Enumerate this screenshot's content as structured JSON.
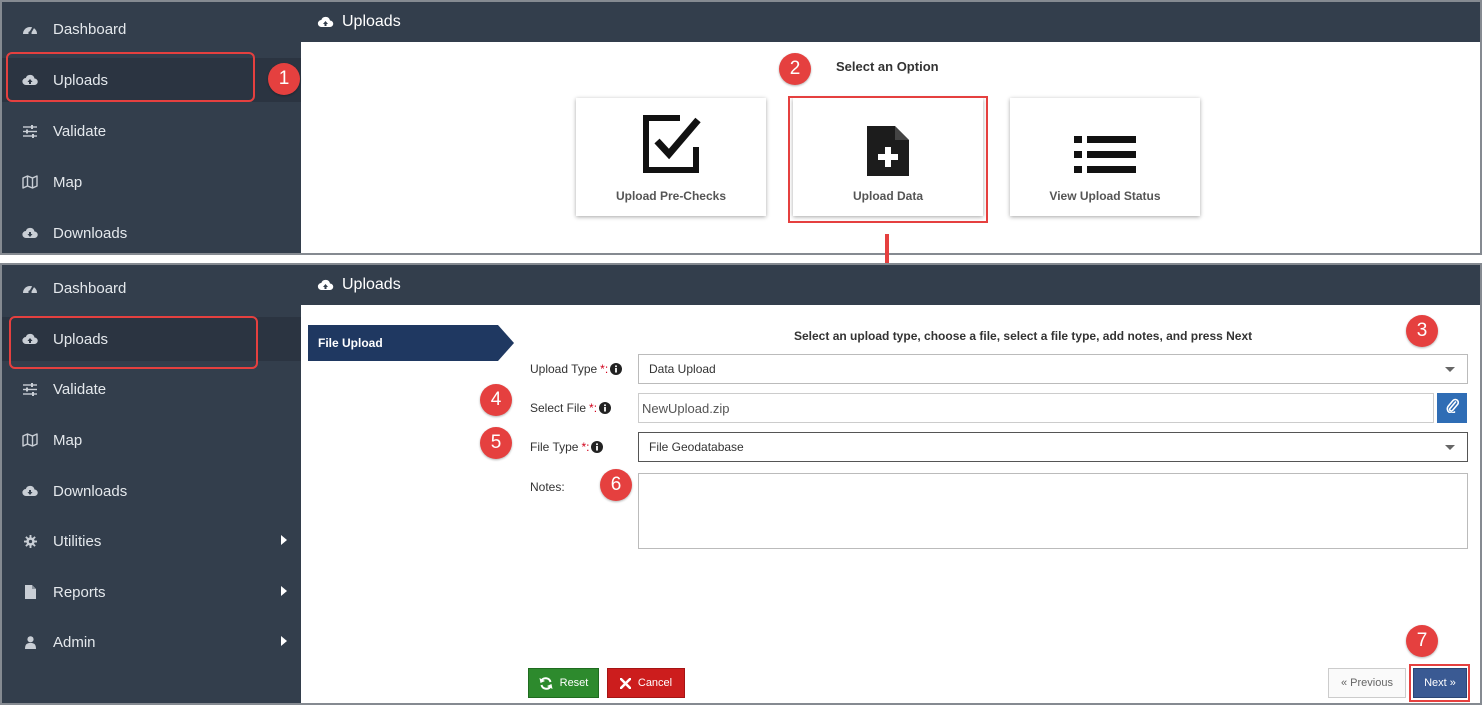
{
  "top": {
    "header_title": "Uploads",
    "sidebar": [
      {
        "label": "Dashboard",
        "icon": "dashboard-icon"
      },
      {
        "label": "Uploads",
        "icon": "cloud-upload-icon"
      },
      {
        "label": "Validate",
        "icon": "sliders-icon"
      },
      {
        "label": "Map",
        "icon": "map-icon"
      },
      {
        "label": "Downloads",
        "icon": "cloud-download-icon"
      }
    ],
    "select_title": "Select an Option",
    "options": [
      {
        "label": "Upload Pre-Checks",
        "icon": "checkbox-icon"
      },
      {
        "label": "Upload Data",
        "icon": "file-plus-icon"
      },
      {
        "label": "View Upload Status",
        "icon": "list-icon"
      }
    ]
  },
  "bottom": {
    "header_title": "Uploads",
    "sidebar": [
      {
        "label": "Dashboard",
        "icon": "dashboard-icon"
      },
      {
        "label": "Uploads",
        "icon": "cloud-upload-icon"
      },
      {
        "label": "Validate",
        "icon": "sliders-icon"
      },
      {
        "label": "Map",
        "icon": "map-icon"
      },
      {
        "label": "Downloads",
        "icon": "cloud-download-icon"
      },
      {
        "label": "Utilities",
        "icon": "gear-icon"
      },
      {
        "label": "Reports",
        "icon": "document-icon"
      },
      {
        "label": "Admin",
        "icon": "user-icon"
      }
    ],
    "step_tab": "File Upload",
    "instructions": "Select an upload type, choose a file, select a file type, add notes, and press Next",
    "form": {
      "upload_type_label": "Upload Type",
      "upload_type_value": "Data Upload",
      "select_file_label": "Select File",
      "select_file_value": "NewUpload.zip",
      "file_type_label": "File Type",
      "file_type_value": "File Geodatabase",
      "notes_label": "Notes:",
      "notes_value": "",
      "required_marker": "*:"
    },
    "buttons": {
      "reset": "Reset",
      "cancel": "Cancel",
      "previous": "« Previous",
      "next": "Next »"
    }
  },
  "annotations": [
    "1",
    "2",
    "3",
    "4",
    "5",
    "6",
    "7"
  ],
  "colors": {
    "sidebar_bg": "#333e4c",
    "highlight": "#e5403f",
    "step_tab": "#1f3861",
    "reset": "#2d8a2d",
    "cancel": "#cc1d1d",
    "next": "#3a5a93"
  }
}
